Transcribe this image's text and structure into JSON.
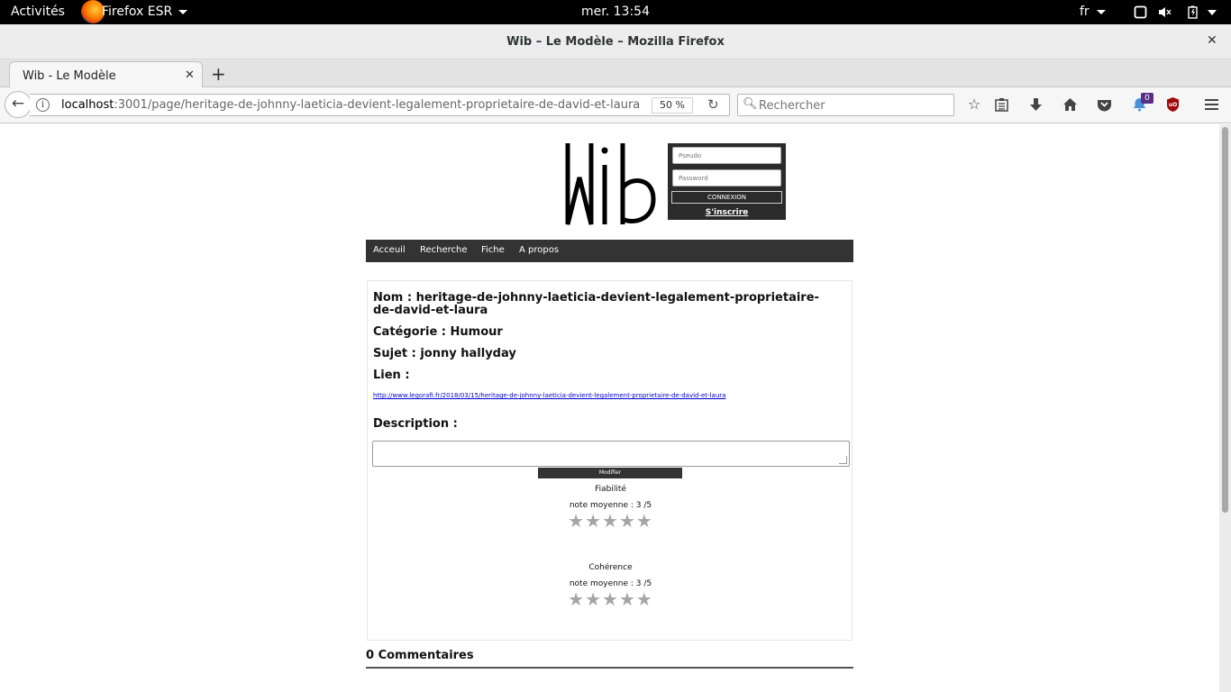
{
  "topbar": {
    "activities": "Activités",
    "app_name": "Firefox ESR",
    "clock": "mer. 13:54",
    "lang": "fr"
  },
  "window": {
    "title": "Wib – Le Modèle – Mozilla Firefox"
  },
  "tabs": [
    {
      "label": "Wib - Le Modèle"
    }
  ],
  "navbar": {
    "url_host": "localhost",
    "url_rest": ":3001/page/heritage-de-johnny-laeticia-devient-legalement-proprietaire-de-david-et-laura",
    "zoom": "50 %",
    "search_placeholder": "Rechercher",
    "badge_count": "0"
  },
  "page": {
    "login": {
      "pseudo_placeholder": "Pseudo",
      "password_placeholder": "Password",
      "connect_label": "CONNEXION",
      "signup_label": "S'inscrire"
    },
    "nav": [
      "Acceuil",
      "Recherche",
      "Fiche",
      "A propos"
    ],
    "item": {
      "nom_line1": "Nom : heritage-de-johnny-laeticia-devient-legalement-proprietaire-",
      "nom_line2": "de-david-et-laura",
      "categorie": "Catégorie : Humour",
      "sujet": "Sujet : jonny hallyday",
      "lien_label": "Lien :",
      "lien_url": "http://www.legorafi.fr/2018/03/15/heritage-de-johnny-laeticia-devient-legalement-proprietaire-de-david-et-laura",
      "description_label": "Description :",
      "modifier_label": "Modifier"
    },
    "ratings": [
      {
        "label": "Fiabilité",
        "average": "note moyenne : 3 /5",
        "stars": "★★★★★"
      },
      {
        "label": "Cohérence",
        "average": "note moyenne : 3 /5",
        "stars": "★★★★★"
      }
    ],
    "comments": "0 Commentaires"
  }
}
